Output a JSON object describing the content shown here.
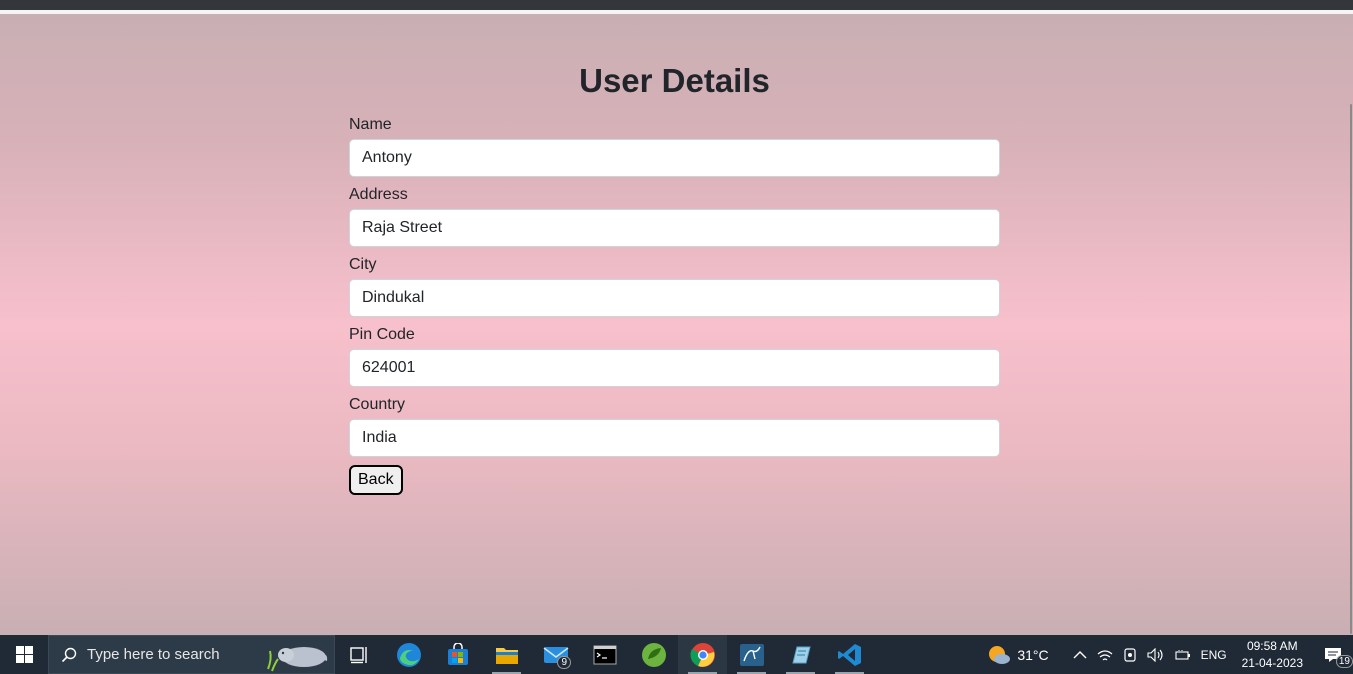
{
  "page": {
    "title": "User Details",
    "fields": [
      {
        "label": "Name",
        "value": "Antony"
      },
      {
        "label": "Address",
        "value": "Raja Street"
      },
      {
        "label": "City",
        "value": "Dindukal"
      },
      {
        "label": "Pin Code",
        "value": "624001"
      },
      {
        "label": "Country",
        "value": "India"
      }
    ],
    "back_label": "Back"
  },
  "taskbar": {
    "search_placeholder": "Type here to search",
    "mail_badge": "9",
    "weather": "31°C",
    "language": "ENG",
    "time": "09:58 AM",
    "date": "21-04-2023",
    "notifications": "19"
  }
}
